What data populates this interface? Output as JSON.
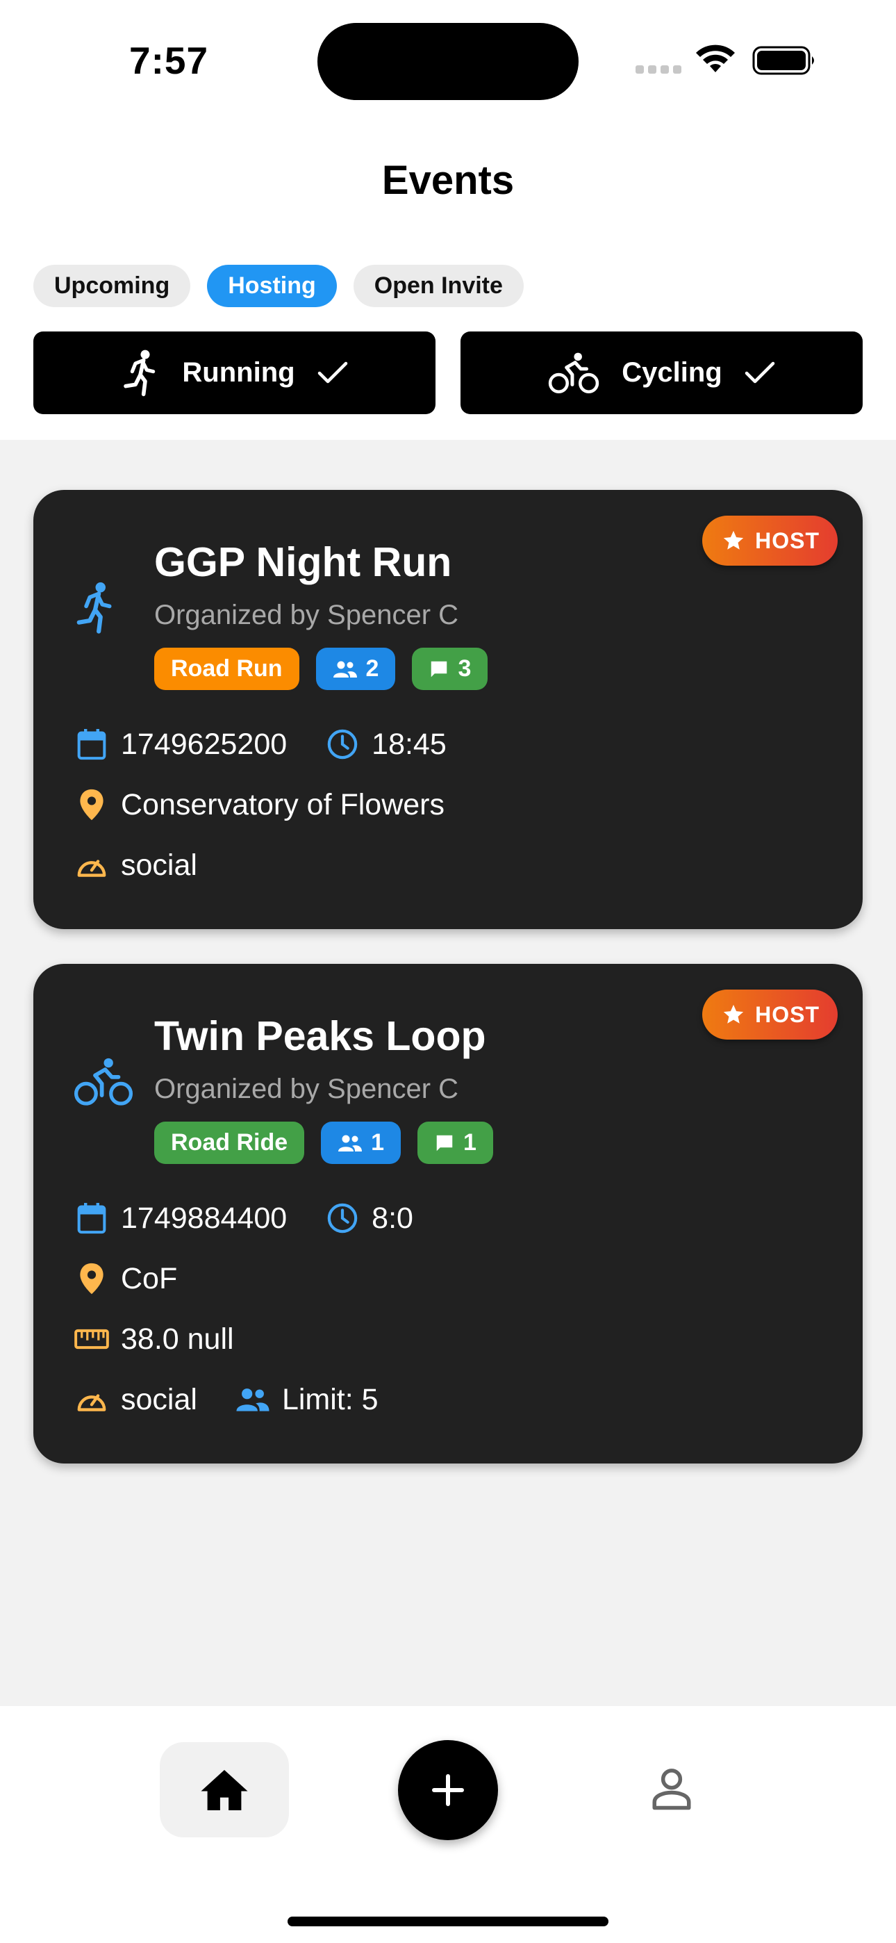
{
  "status_bar": {
    "time": "7:57"
  },
  "header": {
    "title": "Events"
  },
  "filters": {
    "chips": [
      {
        "label": "Upcoming",
        "active": false
      },
      {
        "label": "Hosting",
        "active": true
      },
      {
        "label": "Open Invite",
        "active": false
      }
    ],
    "sports": [
      {
        "label": "Running",
        "icon": "running-icon",
        "selected": true
      },
      {
        "label": "Cycling",
        "icon": "cycling-icon",
        "selected": true
      }
    ]
  },
  "events": [
    {
      "host_badge": "HOST",
      "activity_icon": "running-icon",
      "title": "GGP Night Run",
      "organizer": "Organized by Spencer C",
      "type_tag": "Road Run",
      "participants": "2",
      "comments": "3",
      "date": "1749625200",
      "time": "18:45",
      "location": "Conservatory of Flowers",
      "pace": "social"
    },
    {
      "host_badge": "HOST",
      "activity_icon": "cycling-icon",
      "title": "Twin Peaks Loop",
      "organizer": "Organized by Spencer C",
      "type_tag": "Road Ride",
      "participants": "1",
      "comments": "1",
      "date": "1749884400",
      "time": "8:0",
      "location": "CoF",
      "distance": "38.0 null",
      "pace": "social",
      "limit": "Limit: 5"
    }
  ],
  "colors": {
    "accent_blue": "#2196f3",
    "card_bg": "#212121",
    "host_gradient_start": "#ef7b11",
    "host_gradient_end": "#e43d2f",
    "tag_orange": "#fb8c00",
    "tag_green": "#43a047",
    "tag_blue": "#1e88e5",
    "icon_blue": "#42a5f5",
    "icon_orange": "#ffb74d"
  }
}
